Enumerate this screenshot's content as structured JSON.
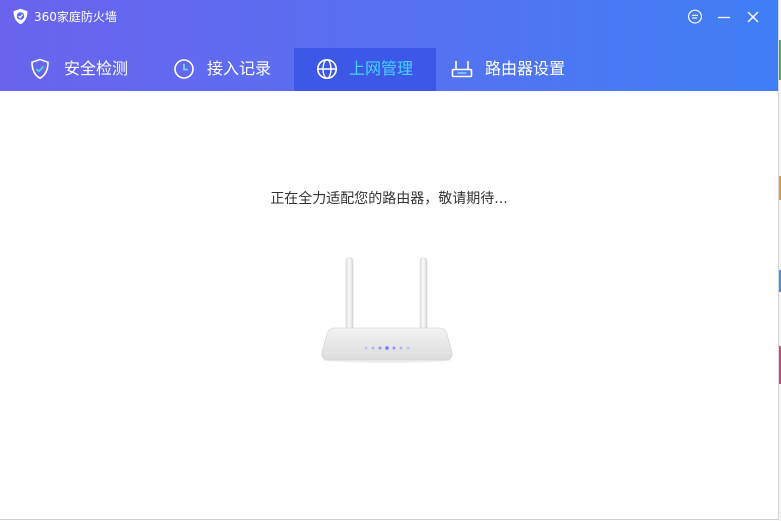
{
  "app": {
    "title": "360家庭防火墙",
    "logo_icon": "shield-360-logo"
  },
  "window_controls": [
    {
      "name": "feedback",
      "icon": "chat-bubble-icon"
    },
    {
      "name": "minimize",
      "icon": "minimize-icon"
    },
    {
      "name": "close",
      "icon": "close-icon"
    }
  ],
  "tabs": [
    {
      "label": "安全检测",
      "icon": "shield-check-icon",
      "active": false
    },
    {
      "label": "接入记录",
      "icon": "clock-icon",
      "active": false
    },
    {
      "label": "上网管理",
      "icon": "globe-icon",
      "active": true
    },
    {
      "label": "路由器设置",
      "icon": "router-icon",
      "active": false
    }
  ],
  "main": {
    "status_message": "正在全力适配您的路由器，敬请期待...",
    "illustration": "router-illustration"
  },
  "colors": {
    "header_gradient_start": "#6a63ee",
    "header_gradient_end": "#3f7ff5",
    "active_tab_bg": "#3d58e6",
    "active_tab_text": "#3fd6ff",
    "router_led": "#6f7df5"
  }
}
